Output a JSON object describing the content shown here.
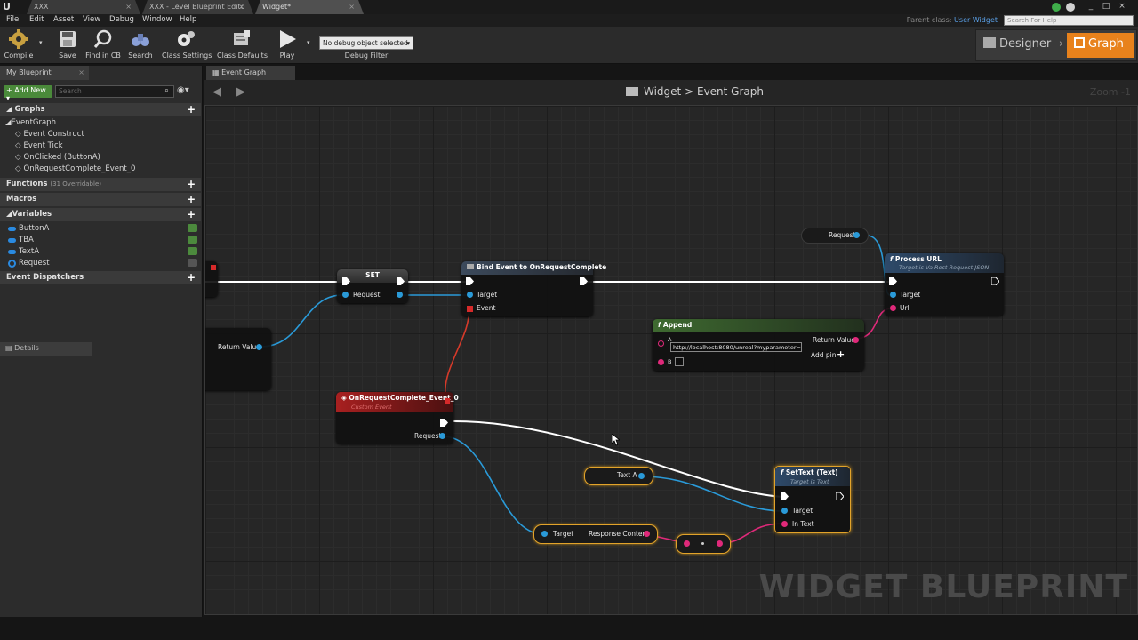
{
  "window": {
    "tabs": [
      "XXX",
      "XXX - Level Blueprint Edito",
      "Widget*"
    ]
  },
  "menu": [
    "File",
    "Edit",
    "Asset",
    "View",
    "Debug",
    "Window",
    "Help"
  ],
  "parent_class": {
    "label": "Parent class:",
    "value": "User Widget"
  },
  "help_search": {
    "placeholder": "Search For Help"
  },
  "toolbar": {
    "buttons": [
      "Compile",
      "Save",
      "Find in CB",
      "Search",
      "Class Settings",
      "Class Defaults",
      "Play"
    ],
    "debug_select": "No debug object selected",
    "debug_label": "Debug Filter"
  },
  "mode": {
    "designer": "Designer",
    "graph": "Graph"
  },
  "my_blueprint": {
    "tab": "My Blueprint",
    "add_new": "Add New",
    "search_placeholder": "Search",
    "graphs_header": "Graphs",
    "graph_root": "EventGraph",
    "events": [
      "Event Construct",
      "Event Tick",
      "OnClicked (ButtonA)",
      "OnRequestComplete_Event_0"
    ],
    "functions_header": "Functions",
    "functions_count": "(31 Overridable)",
    "macros_header": "Macros",
    "variables_header": "Variables",
    "variables": [
      "ButtonA",
      "TBA",
      "TextA",
      "Request"
    ],
    "dispatchers_header": "Event Dispatchers"
  },
  "details": {
    "tab": "Details"
  },
  "graph": {
    "tab": "Event Graph",
    "breadcrumb_root": "Widget",
    "breadcrumb_sep": ">",
    "breadcrumb_leaf": "Event Graph",
    "zoom": "Zoom -1",
    "watermark": "WIDGET BLUEPRINT"
  },
  "nodes": {
    "set": {
      "title": "SET",
      "pin": "Request"
    },
    "bind": {
      "title": "Bind Event to OnRequestComplete",
      "pins": [
        "Target",
        "Event"
      ]
    },
    "request_get": {
      "pin": "Request"
    },
    "process_url": {
      "title": "Process URL",
      "subtitle": "Target is Va Rest Request JSON",
      "pins": [
        "Target",
        "Url"
      ]
    },
    "append": {
      "title": "Append",
      "pin_a": "A",
      "pin_b": "B",
      "a_value": "http://localhost:8080/unreal?myparameter=",
      "return": "Return Value",
      "add_pin": "Add pin"
    },
    "return_value": {
      "pin": "Return Value"
    },
    "custom_event": {
      "title": "OnRequestComplete_Event_0",
      "subtitle": "Custom Event",
      "pin": "Request"
    },
    "text_a": {
      "pin": "Text A"
    },
    "set_text": {
      "title": "SetText (Text)",
      "subtitle": "Target is Text",
      "pins": [
        "Target",
        "In Text"
      ]
    },
    "response": {
      "pin_in": "Target",
      "pin_out": "Response Content"
    }
  }
}
